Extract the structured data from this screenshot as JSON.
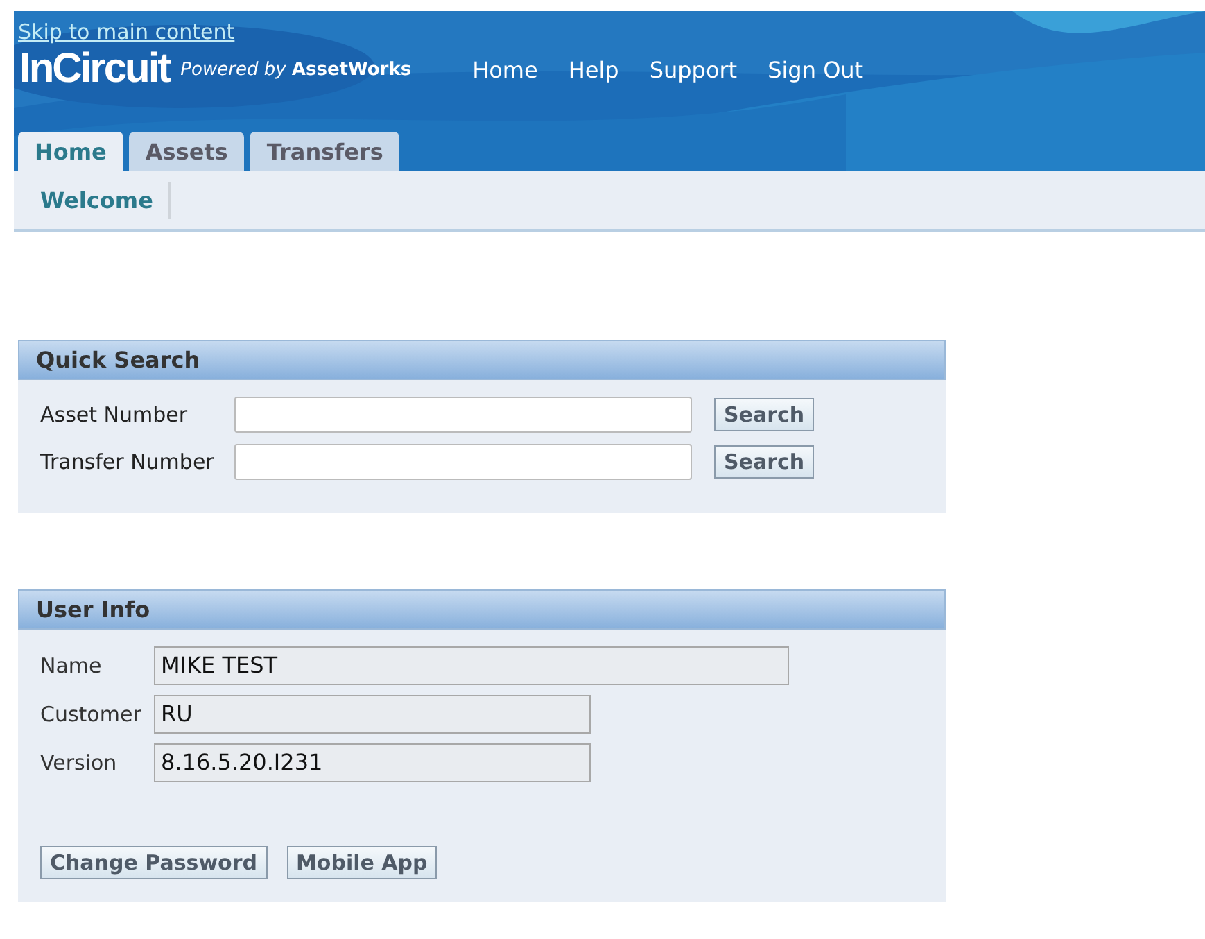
{
  "skip_link": "Skip to main content",
  "logo": {
    "name": "InCircuit",
    "tagline": "*Powered by* **AssetWorks**"
  },
  "global_links": [
    "Home",
    "Help",
    "Support",
    "Sign Out"
  ],
  "tabs": [
    {
      "label": "Home",
      "selected": true
    },
    {
      "label": "Assets",
      "selected": false
    },
    {
      "label": "Transfers",
      "selected": false
    }
  ],
  "subtabs": [
    {
      "label": "Welcome",
      "selected": true
    }
  ],
  "quick_search": {
    "title": "Quick Search",
    "fields": [
      {
        "label": "Asset Number",
        "button": "Search"
      },
      {
        "label": "Transfer Number",
        "button": "Search"
      }
    ]
  },
  "user_info": {
    "title": "User Info",
    "fields": [
      {
        "label": "Name",
        "value": "MIKE TEST"
      },
      {
        "label": "Customer",
        "value": "RU"
      },
      {
        "label": "Version",
        "value": "8.16.5.20.I231"
      }
    ],
    "buttons": [
      "Change Password",
      "Mobile App"
    ]
  }
}
